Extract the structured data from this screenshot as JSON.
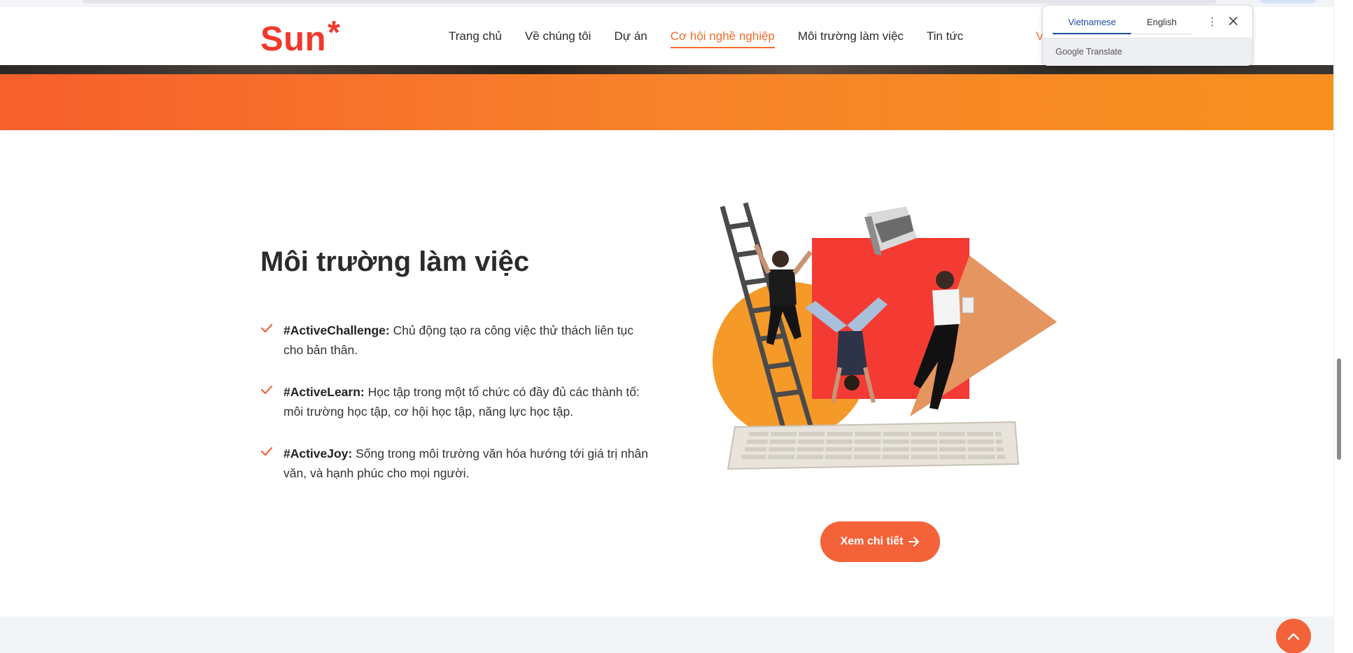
{
  "header": {
    "logo_text": "Sun",
    "logo_star": "*",
    "nav": [
      {
        "label": "Trang chủ",
        "active": false
      },
      {
        "label": "Về chúng tôi",
        "active": false
      },
      {
        "label": "Dự án",
        "active": false
      },
      {
        "label": "Cơ hội nghề nghiệp",
        "active": true
      },
      {
        "label": "Môi trường làm việc",
        "active": false
      },
      {
        "label": "Tin tức",
        "active": false
      }
    ],
    "nav_cut_label": "V"
  },
  "section": {
    "title": "Môi trường làm việc",
    "items": [
      {
        "tag": "#ActiveChallenge:",
        "text": " Chủ động tạo ra công việc thử thách liên tục cho bản thân."
      },
      {
        "tag": "#ActiveLearn:",
        "text": " Học tập trong một tổ chức có đầy đủ các thành tố: môi trường học tập, cơ hội học tập, năng lực học tập."
      },
      {
        "tag": "#ActiveJoy:",
        "text": " Sống trong môi trường văn hóa hướng tới giá trị nhân văn, và hạnh phúc cho mọi người."
      }
    ],
    "cta_label": "Xem chi tiết"
  },
  "translate": {
    "tab_active": "Vietnamese",
    "tab_inactive": "English",
    "brand_google": "Google",
    "brand_translate": "Translate"
  },
  "colors": {
    "brand": "#f0392b",
    "accent": "#f26b2a",
    "button": "#f4623a",
    "translate_active": "#1a4d9c"
  }
}
